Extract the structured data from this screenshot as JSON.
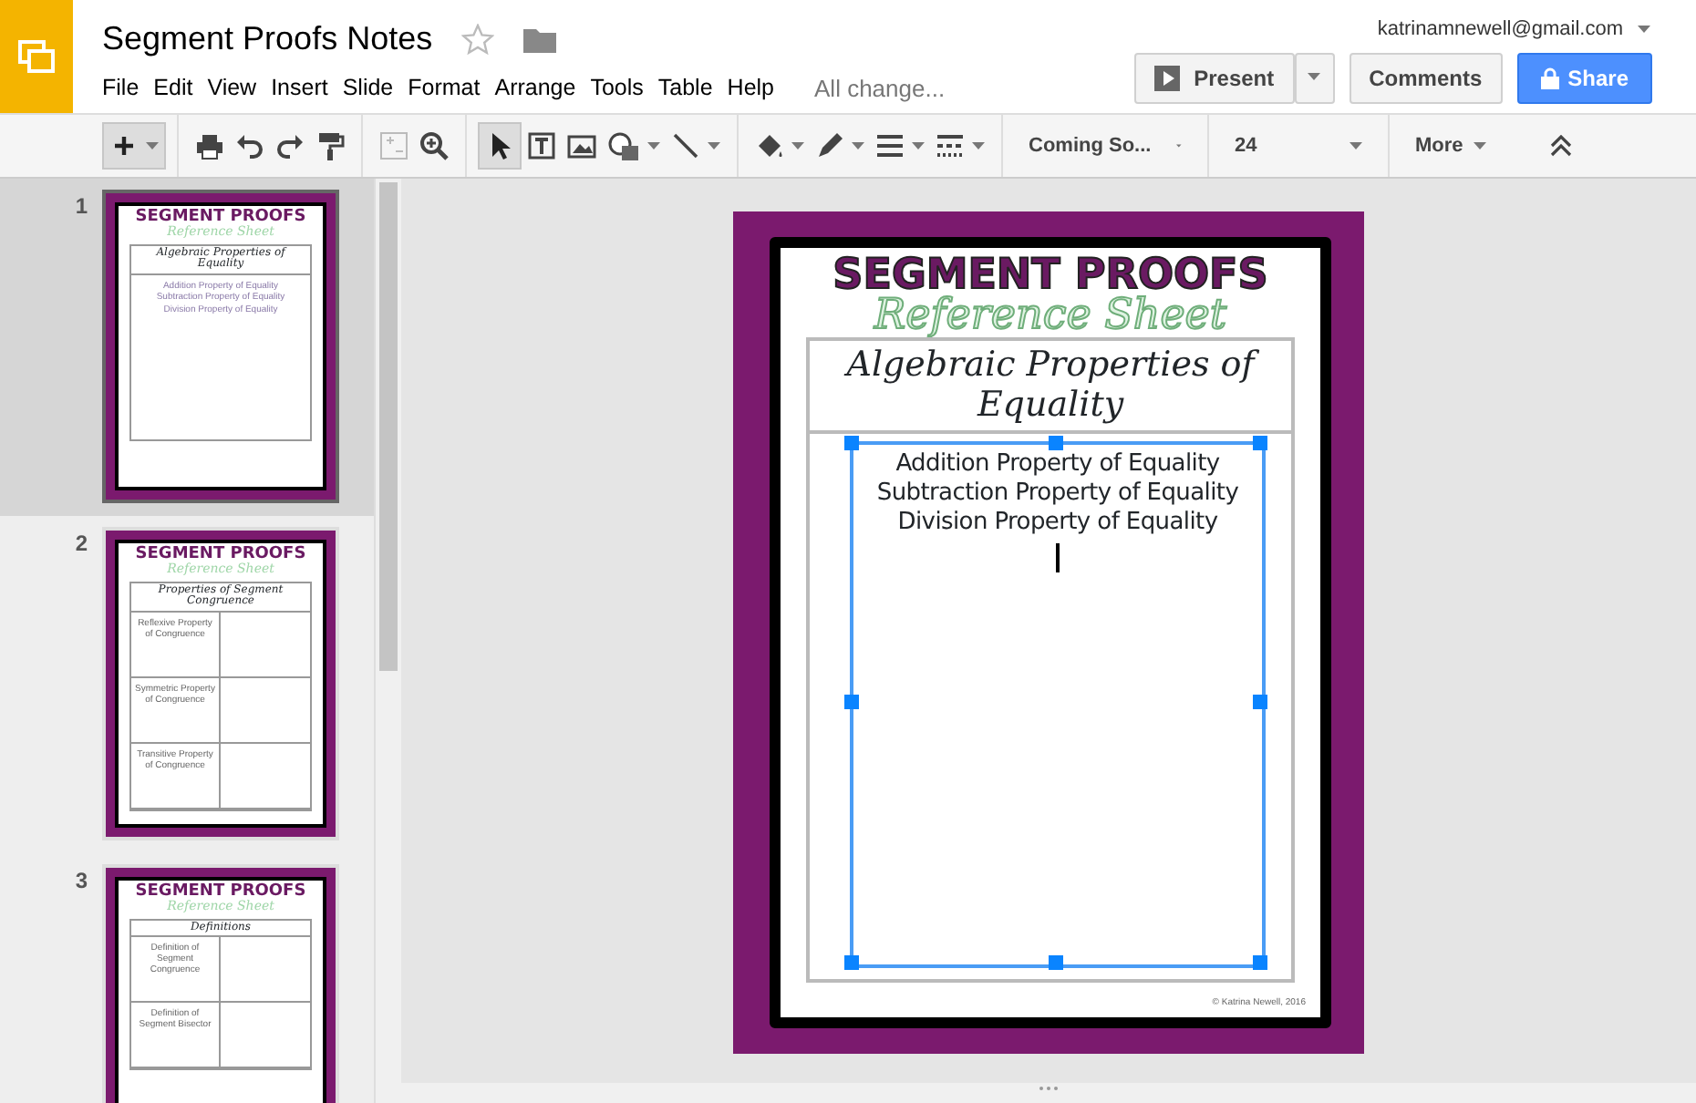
{
  "app": {
    "doc_title": "Segment Proofs Notes",
    "starred": false,
    "account": "katrinamnewell@gmail.com",
    "menu": [
      "File",
      "Edit",
      "View",
      "Insert",
      "Slide",
      "Format",
      "Arrange",
      "Tools",
      "Table",
      "Help"
    ],
    "save_status": "All change...",
    "present": "Present",
    "comments": "Comments",
    "share": "Share"
  },
  "toolbar": {
    "font": "Coming So...",
    "font_size": "24",
    "more": "More"
  },
  "slides": [
    {
      "number": "1",
      "selected": true,
      "kind": "list",
      "title": "SEGMENT PROOFS",
      "subtitle": "Reference Sheet",
      "heading": "Algebraic Properties of Equality",
      "lines": [
        "Addition Property of Equality",
        "Subtraction Property of Equality",
        "Division Property of Equality"
      ]
    },
    {
      "number": "2",
      "selected": false,
      "kind": "table",
      "title": "SEGMENT PROOFS",
      "subtitle": "Reference Sheet",
      "heading": "Properties of Segment Congruence",
      "lines": [
        "Reflexive Property of Congruence",
        "Symmetric Property of Congruence",
        "Transitive Property of Congruence"
      ]
    },
    {
      "number": "3",
      "selected": false,
      "kind": "table",
      "title": "SEGMENT PROOFS",
      "subtitle": "Reference Sheet",
      "heading": "Definitions",
      "lines": [
        "Definition of Segment Congruence",
        "Definition of Segment Bisector"
      ]
    }
  ],
  "editor": {
    "title": "SEGMENT PROOFS",
    "subtitle": "Reference Sheet",
    "heading": "Algebraic Properties of Equality",
    "lines": [
      "Addition Property of Equality",
      "Subtraction Property of Equality",
      "Division Property of Equality"
    ],
    "copyright": "© Katrina Newell, 2016"
  }
}
